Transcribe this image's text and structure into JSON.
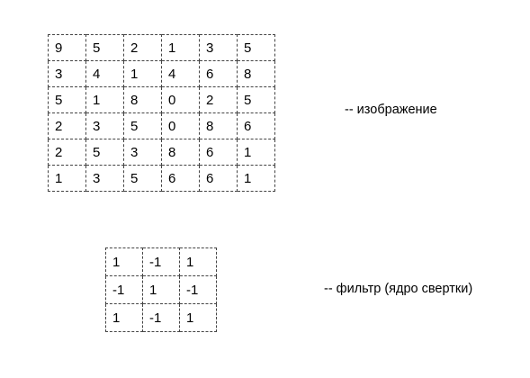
{
  "image_matrix": {
    "label": "-- изображение",
    "rows": [
      [
        "9",
        "5",
        "2",
        "1",
        "3",
        "5"
      ],
      [
        "3",
        "4",
        "1",
        "4",
        "6",
        "8"
      ],
      [
        "5",
        "1",
        "8",
        "0",
        "2",
        "5"
      ],
      [
        "2",
        "3",
        "5",
        "0",
        "8",
        "6"
      ],
      [
        "2",
        "5",
        "3",
        "8",
        "6",
        "1"
      ],
      [
        "1",
        "3",
        "5",
        "6",
        "6",
        "1"
      ]
    ]
  },
  "kernel_matrix": {
    "label": "-- фильтр (ядро свертки)",
    "rows": [
      [
        "1",
        "-1",
        "1"
      ],
      [
        "-1",
        "1",
        "-1"
      ],
      [
        "1",
        "-1",
        "1"
      ]
    ]
  }
}
